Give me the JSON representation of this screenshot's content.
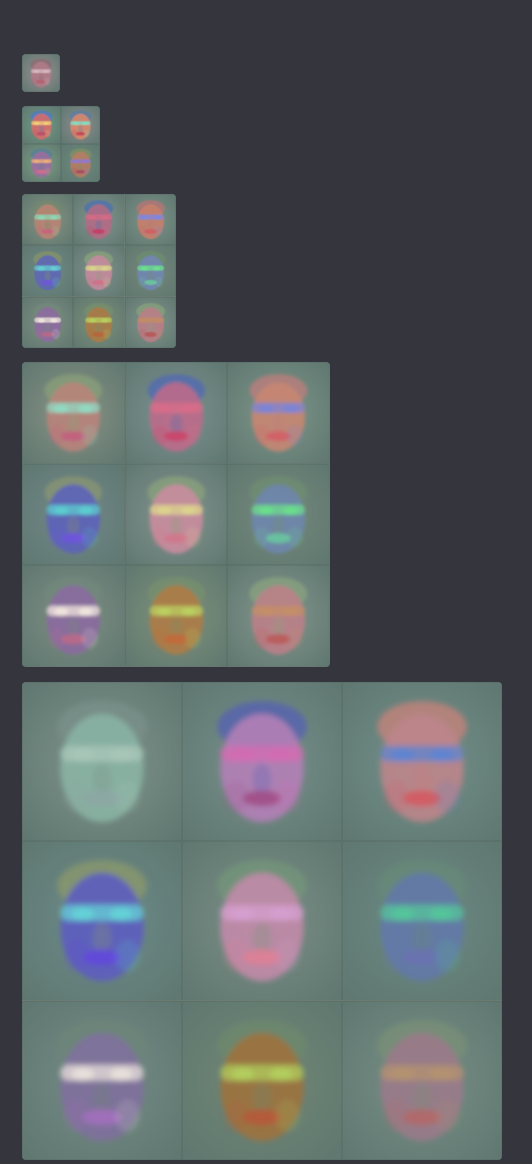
{
  "page": {
    "title": "",
    "background_color": "#35363d"
  },
  "attachments": [
    {
      "name": "attachment-1x1",
      "grid": 1,
      "tiles": [
        {
          "icon": "face-visualization",
          "bg": "#9a8f92",
          "skin": "#b07a88",
          "hair": "#8c6b70",
          "accent": "#d8b9c3",
          "mouth": "#b56170"
        }
      ]
    },
    {
      "name": "attachment-2x2",
      "grid": 2,
      "tiles": [
        {
          "icon": "face-visualization",
          "bg": "#6f9a85",
          "skin": "#d56d6b",
          "hair": "#4f7ac8",
          "accent": "#f1d37a",
          "mouth": "#b84d69"
        },
        {
          "icon": "face-visualization",
          "bg": "#8c8d8f",
          "skin": "#d8886c",
          "hair": "#5a7ca7",
          "accent": "#7fe0c6",
          "mouth": "#c64058"
        },
        {
          "icon": "face-visualization",
          "bg": "#7ca082",
          "skin": "#9a6ea0",
          "hair": "#547d9a",
          "accent": "#f0b078",
          "mouth": "#d96c89"
        },
        {
          "icon": "face-visualization",
          "bg": "#6d8b7d",
          "skin": "#b67c63",
          "hair": "#7d9163",
          "accent": "#8d7ad3",
          "mouth": "#a94961"
        }
      ]
    },
    {
      "name": "attachment-3x3-small",
      "grid": 3,
      "tiles": [
        {
          "icon": "face-visualization",
          "bg": "#86937f",
          "skin": "#b98373",
          "hair": "#73886f",
          "accent": "#8ed6b4",
          "mouth": "#c6657e"
        },
        {
          "icon": "face-visualization",
          "bg": "#83958f",
          "skin": "#b06b85",
          "hair": "#4c70b0",
          "accent": "#d46b86",
          "mouth": "#c43f66"
        },
        {
          "icon": "face-visualization",
          "bg": "#7e9489",
          "skin": "#c6806c",
          "hair": "#b87474",
          "accent": "#7e86e0",
          "mouth": "#cf5f65"
        },
        {
          "icon": "face-visualization",
          "bg": "#6f8a85",
          "skin": "#5e67b5",
          "hair": "#86936a",
          "accent": "#64cfd1",
          "mouth": "#6e56d8"
        },
        {
          "icon": "face-visualization",
          "bg": "#82928d",
          "skin": "#c48a9d",
          "hair": "#87a17a",
          "accent": "#d8d58a",
          "mouth": "#d27186"
        },
        {
          "icon": "face-visualization",
          "bg": "#76897b",
          "skin": "#7186b0",
          "hair": "#6e8d6f",
          "accent": "#6ee08e",
          "mouth": "#6ac6a0"
        },
        {
          "icon": "face-visualization",
          "bg": "#7f8f82",
          "skin": "#8d6b9f",
          "hair": "#73887b",
          "accent": "#efe5de",
          "mouth": "#b86a88"
        },
        {
          "icon": "face-visualization",
          "bg": "#7d9078",
          "skin": "#aa7b45",
          "hair": "#77906b",
          "accent": "#b8d060",
          "mouth": "#b8653a"
        },
        {
          "icon": "face-visualization",
          "bg": "#82958b",
          "skin": "#b97e87",
          "hair": "#88a27c",
          "accent": "#c18d66",
          "mouth": "#b85858"
        }
      ]
    },
    {
      "name": "attachment-3x3-medium",
      "grid": 3,
      "tiles": [
        {
          "icon": "face-visualization",
          "bg": "#8a9384",
          "skin": "#b8837a",
          "hair": "#88a078",
          "accent": "#90dbc4",
          "mouth": "#c4617e"
        },
        {
          "icon": "face-visualization",
          "bg": "#7e9293",
          "skin": "#bc6b8a",
          "hair": "#4f68b3",
          "accent": "#d96d89",
          "mouth": "#cb456a"
        },
        {
          "icon": "face-visualization",
          "bg": "#7d9689",
          "skin": "#c68672",
          "hair": "#c07c7c",
          "accent": "#7a84d8",
          "mouth": "#d35f67"
        },
        {
          "icon": "face-visualization",
          "bg": "#72898b",
          "skin": "#5d62ba",
          "hair": "#8a9571",
          "accent": "#5ccfd0",
          "mouth": "#6f55dd"
        },
        {
          "icon": "face-visualization",
          "bg": "#84948f",
          "skin": "#c98c9e",
          "hair": "#89a27b",
          "accent": "#ddd58d",
          "mouth": "#d2788c"
        },
        {
          "icon": "face-visualization",
          "bg": "#75897c",
          "skin": "#6f86ad",
          "hair": "#6f8e70",
          "accent": "#6ce08b",
          "mouth": "#69c7a0"
        },
        {
          "icon": "face-visualization",
          "bg": "#7f8f84",
          "skin": "#8b6aa0",
          "hair": "#72887b",
          "accent": "#f2e7df",
          "mouth": "#bb6a88"
        },
        {
          "icon": "face-visualization",
          "bg": "#7f9279",
          "skin": "#ae7c46",
          "hair": "#77906c",
          "accent": "#bbd262",
          "mouth": "#c2693b"
        },
        {
          "icon": "face-visualization",
          "bg": "#83968c",
          "skin": "#bb7f88",
          "hair": "#89a27d",
          "accent": "#c48f67",
          "mouth": "#ba5a5a"
        }
      ]
    },
    {
      "name": "attachment-3x3-large",
      "grid": 3,
      "tiles": [
        {
          "icon": "face-visualization",
          "bg": "#7f938c",
          "skin": "#8ab4a4",
          "hair": "#79908a",
          "accent": "#a9c7b9",
          "mouth": "#8ea7a3"
        },
        {
          "icon": "face-visualization",
          "bg": "#78908c",
          "skin": "#b47fb7",
          "hair": "#5460b4",
          "accent": "#d46bb2",
          "mouth": "#a14d86"
        },
        {
          "icon": "face-visualization",
          "bg": "#73908b",
          "skin": "#bd858b",
          "hair": "#c98379",
          "accent": "#5c84d2",
          "mouth": "#d45a62"
        },
        {
          "icon": "face-visualization",
          "bg": "#6d8c8b",
          "skin": "#5c5dc0",
          "hair": "#8b996b",
          "accent": "#65d4d8",
          "mouth": "#6347dd"
        },
        {
          "icon": "face-visualization",
          "bg": "#7b8f86",
          "skin": "#c28aa9",
          "hair": "#74967a",
          "accent": "#d5a0d0",
          "mouth": "#de7f96"
        },
        {
          "icon": "face-visualization",
          "bg": "#6b8a84",
          "skin": "#6279a8",
          "hair": "#678978",
          "accent": "#55c79b",
          "mouth": "#6a72b1"
        },
        {
          "icon": "face-visualization",
          "bg": "#768b87",
          "skin": "#7f709d",
          "hair": "#6c8578",
          "accent": "#e9e2dc",
          "mouth": "#a46fbf"
        },
        {
          "icon": "face-visualization",
          "bg": "#718774",
          "skin": "#9d723e",
          "hair": "#6d8a6d",
          "accent": "#b2cf5e",
          "mouth": "#b6583c"
        },
        {
          "icon": "face-visualization",
          "bg": "#778f86",
          "skin": "#9a7a8a",
          "hair": "#7a9077",
          "accent": "#b49370",
          "mouth": "#b36868"
        }
      ]
    }
  ]
}
